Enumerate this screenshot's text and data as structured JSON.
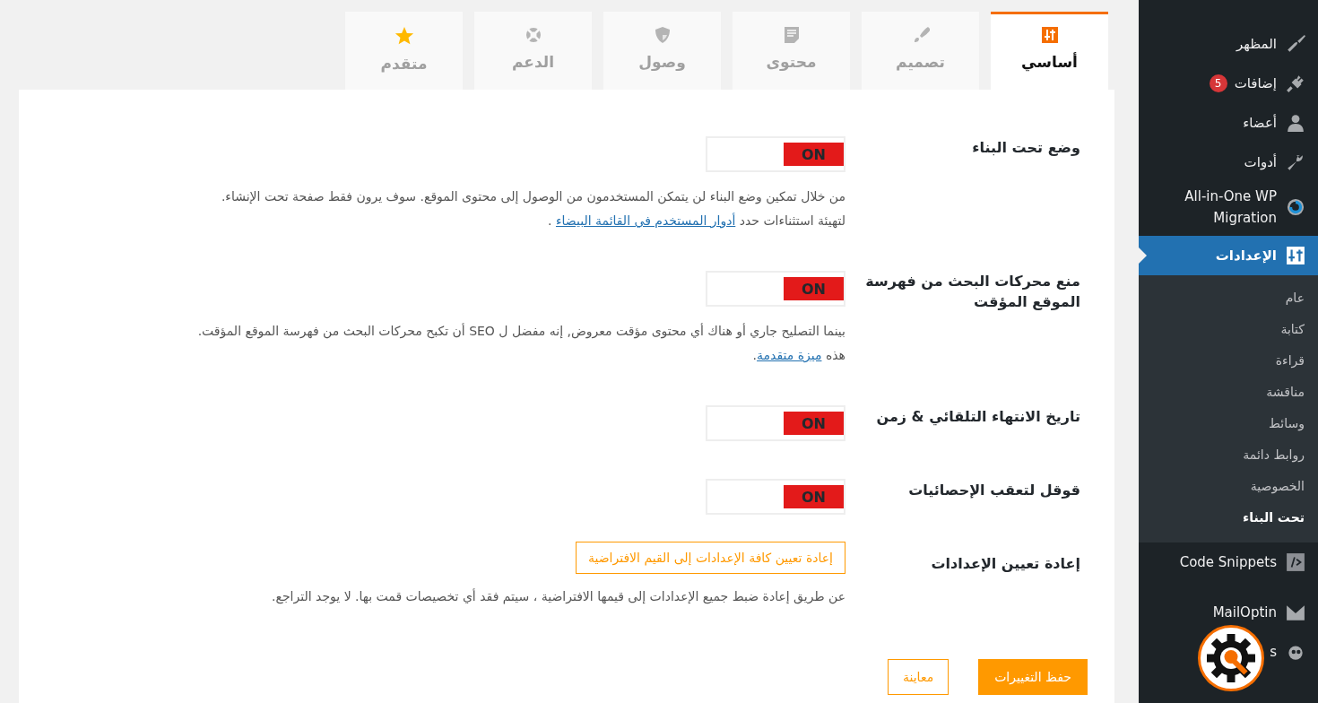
{
  "sidebar": {
    "items": [
      {
        "label": "المظهر",
        "selected": false
      },
      {
        "label": "إضافات",
        "badge": "5",
        "selected": false
      },
      {
        "label": "أعضاء",
        "selected": false
      },
      {
        "label": "أدوات",
        "selected": false
      },
      {
        "label": "All-in-One WP Migration",
        "selected": false
      },
      {
        "label": "الإعدادات",
        "selected": true,
        "children": [
          {
            "label": "عام",
            "selected": false
          },
          {
            "label": "كتابة",
            "selected": false
          },
          {
            "label": "قراءة",
            "selected": false
          },
          {
            "label": "مناقشة",
            "selected": false
          },
          {
            "label": "وسائط",
            "selected": false
          },
          {
            "label": "روابط دائمة",
            "selected": false
          },
          {
            "label": "الخصوصية",
            "selected": false
          },
          {
            "label": "تحت البناء",
            "selected": true
          }
        ]
      },
      {
        "label": "Code Snippets",
        "selected": false
      },
      {
        "label": "MailOptin",
        "selected": false
      },
      {
        "label": "s",
        "selected": false
      }
    ]
  },
  "tabs": [
    {
      "label": "أساسي",
      "selected": true
    },
    {
      "label": "تصميم",
      "selected": false
    },
    {
      "label": "محتوى",
      "selected": false
    },
    {
      "label": "وصول",
      "selected": false
    },
    {
      "label": "الدعم",
      "selected": false
    },
    {
      "label": "متقدم",
      "selected": false
    }
  ],
  "settings": [
    {
      "kind": "toggle",
      "label": "وضع تحت البناء",
      "on": true,
      "toggle_text": "ON",
      "description": [
        {
          "text": "من خلال تمكين وضع البناء لن يتمكن المستخدمون من الوصول إلى محتوى الموقع. سوف يرون فقط صفحة تحت الإنشاء."
        },
        {
          "text": "لتهيئة استثناءات حدد ",
          "link": "أدوار المستخدم في القائمة البيضاء",
          "after": " ."
        }
      ]
    },
    {
      "kind": "toggle",
      "label": "منع محركات البحث من فهرسة الموقع المؤقت",
      "on": true,
      "toggle_text": "ON",
      "description": [
        {
          "text": "بينما التصليح جاري أو هناك أي محتوى مؤقت معروض, إنه مفضل ل SEO أن تكبح محركات البحث من فهرسة الموقع المؤقت."
        },
        {
          "text": "هذه ",
          "link": "ميزة متقدمة",
          "after": "."
        }
      ]
    },
    {
      "kind": "toggle",
      "label": "تاريخ الانتهاء التلقائي & زمن",
      "on": true,
      "toggle_text": "ON"
    },
    {
      "kind": "toggle",
      "label": "قوقل لتعقب الإحصائيات",
      "on": true,
      "toggle_text": "ON"
    },
    {
      "kind": "button",
      "label": "إعادة تعيين الإعدادات",
      "button": "إعادة تعيين كافة الإعدادات إلى القيم الافتراضية",
      "description": [
        {
          "text": "عن طريق إعادة ضبط جميع الإعدادات إلى قيمها الافتراضية ، سيتم فقد أي تخصيصات قمت بها. لا يوجد التراجع."
        }
      ]
    }
  ],
  "actions": [
    {
      "label": "حفظ التغييرات",
      "kind": "primary"
    },
    {
      "label": "معاينة",
      "kind": "secondary"
    }
  ]
}
